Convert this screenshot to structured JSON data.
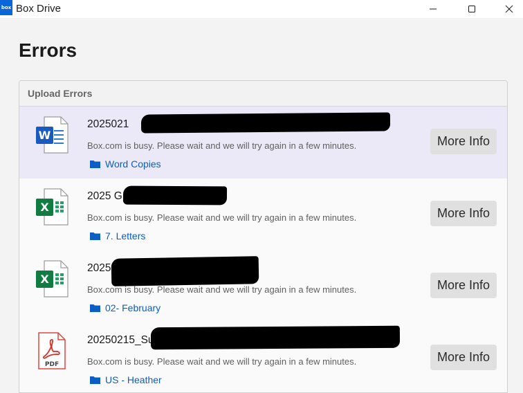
{
  "window": {
    "logo_text": "box",
    "title": "Box Drive",
    "controls": [
      "minimize",
      "maximize",
      "close"
    ]
  },
  "page": {
    "title": "Errors"
  },
  "panel": {
    "header": "Upload Errors",
    "items": [
      {
        "file_type": "word",
        "name": "2025021",
        "message": "Box.com is busy. Please wait and we will try again in a few minutes.",
        "folder": "Word Copies",
        "button": "More Info",
        "selected": true
      },
      {
        "file_type": "excel",
        "name": "2025 G",
        "message": "Box.com is busy. Please wait and we will try again in a few minutes.",
        "folder": "7. Letters",
        "button": "More Info",
        "selected": false
      },
      {
        "file_type": "excel",
        "name": "2025",
        "message": "Box.com is busy. Please wait and we will try again in a few minutes.",
        "folder": "02- February",
        "button": "More Info",
        "selected": false
      },
      {
        "file_type": "pdf",
        "name": "20250215_Su",
        "message": "Box.com is busy. Please wait and we will try again in a few minutes.",
        "folder": "US - Heather",
        "button": "More Info",
        "selected": false
      }
    ]
  },
  "colors": {
    "accent": "#0061d5",
    "link": "#0a5ec4",
    "selected_row": "#ebe9f7",
    "word": "#185abd",
    "excel": "#107c41",
    "pdf": "#d93025"
  }
}
